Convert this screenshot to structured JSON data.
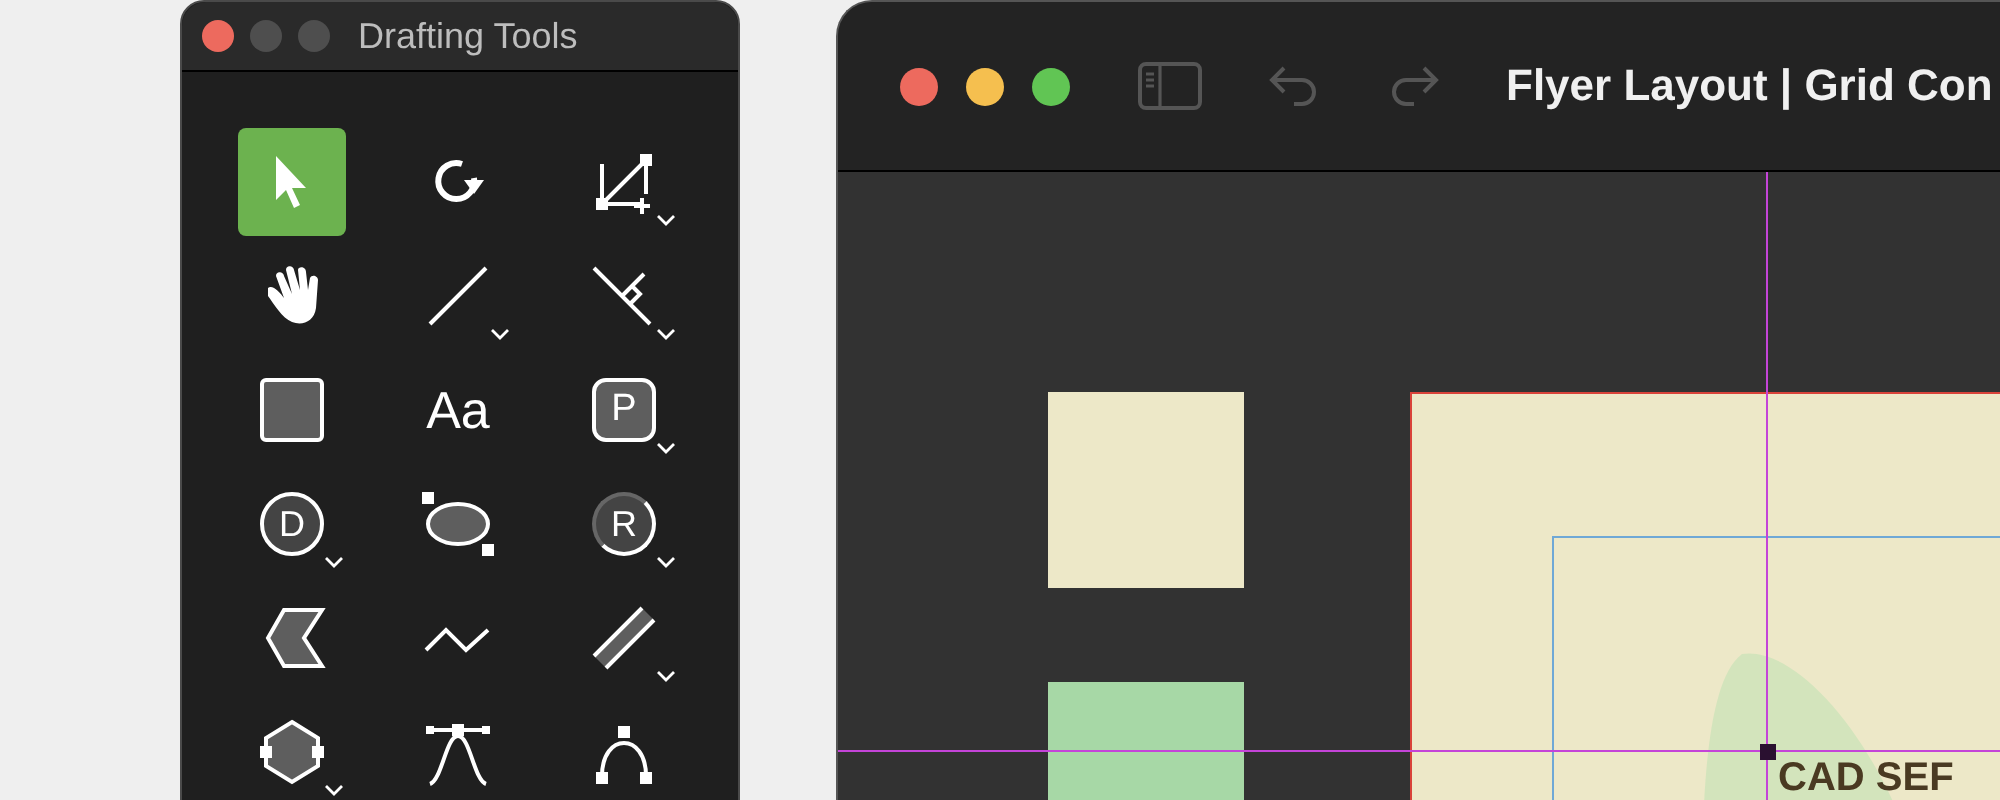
{
  "palette": {
    "title": "Drafting Tools",
    "tools": [
      {
        "kind": "pointer",
        "selected": true,
        "submenu": false
      },
      {
        "kind": "rotate",
        "selected": false,
        "submenu": false
      },
      {
        "kind": "crop",
        "selected": false,
        "submenu": true
      },
      {
        "kind": "hand",
        "selected": false,
        "submenu": false
      },
      {
        "kind": "line",
        "selected": false,
        "submenu": true
      },
      {
        "kind": "perpendicular",
        "selected": false,
        "submenu": true
      },
      {
        "kind": "rectangle",
        "selected": false,
        "submenu": false
      },
      {
        "kind": "text",
        "label": "Aa",
        "selected": false,
        "submenu": false
      },
      {
        "kind": "rounded-letter",
        "label": "P",
        "selected": false,
        "submenu": true
      },
      {
        "kind": "circle-letter",
        "label": "D",
        "selected": false,
        "submenu": true
      },
      {
        "kind": "ellipse",
        "selected": false,
        "submenu": false
      },
      {
        "kind": "arc-letter",
        "label": "R",
        "selected": false,
        "submenu": true
      },
      {
        "kind": "chevron",
        "selected": false,
        "submenu": false
      },
      {
        "kind": "zigzag",
        "selected": false,
        "submenu": false
      },
      {
        "kind": "double-line",
        "selected": false,
        "submenu": true
      },
      {
        "kind": "hexagon",
        "selected": false,
        "submenu": true
      },
      {
        "kind": "bezier",
        "selected": false,
        "submenu": false
      },
      {
        "kind": "arch",
        "selected": false,
        "submenu": false
      }
    ]
  },
  "document": {
    "title": "Flyer Layout | Grid Con",
    "canvas": {
      "headline": "CAD SEF"
    }
  }
}
